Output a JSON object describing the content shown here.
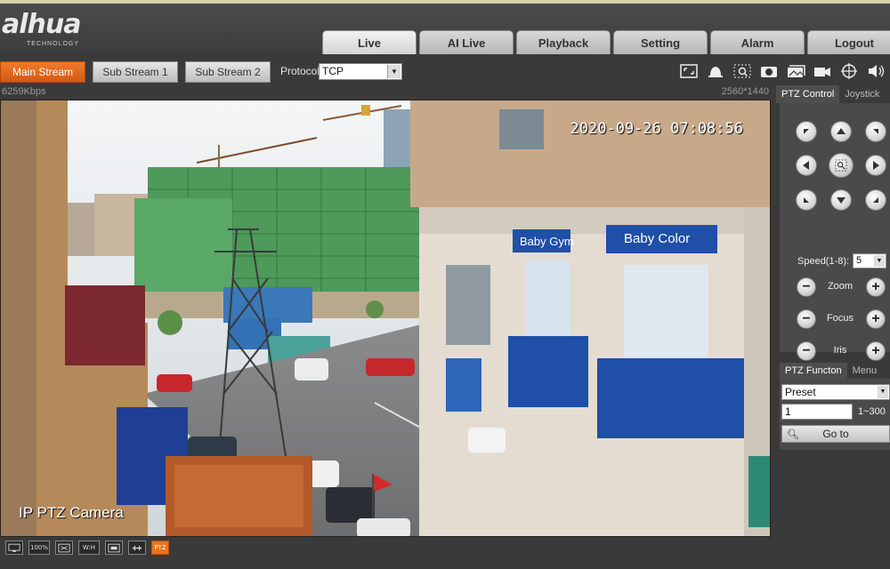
{
  "brand": {
    "name": "alhua",
    "tagline": "TECHNOLOGY"
  },
  "nav": {
    "tabs": [
      {
        "label": "Live",
        "active": true
      },
      {
        "label": "AI Live",
        "active": false
      },
      {
        "label": "Playback",
        "active": false
      },
      {
        "label": "Setting",
        "active": false
      },
      {
        "label": "Alarm",
        "active": false
      },
      {
        "label": "Logout",
        "active": false
      }
    ]
  },
  "toolbar": {
    "streams": [
      {
        "label": "Main Stream",
        "active": true
      },
      {
        "label": "Sub Stream 1",
        "active": false
      },
      {
        "label": "Sub Stream 2",
        "active": false
      }
    ],
    "protocol_label": "Protocol",
    "protocol_value": "TCP",
    "icons": [
      "fullscreen-icon",
      "alarm-bell-icon",
      "zoom-region-icon",
      "snapshot-icon",
      "burst-snapshot-icon",
      "record-icon",
      "target-icon",
      "audio-icon"
    ]
  },
  "status": {
    "bitrate": "6259Kbps",
    "resolution": "2560*1440"
  },
  "video": {
    "timestamp": "2020-09-26 07:08:56",
    "camera_name": "IP PTZ Camera",
    "signs": {
      "gym": "Baby Gym",
      "color": "Baby Color"
    }
  },
  "bottombar": {
    "items": [
      {
        "name": "monitor-icon",
        "text": ""
      },
      {
        "name": "original-size-button",
        "text": "100%"
      },
      {
        "name": "fit-window-button",
        "text": ""
      },
      {
        "name": "aspect-ratio-button",
        "text": "W:H"
      },
      {
        "name": "display-mode-button",
        "text": ""
      },
      {
        "name": "fluency-button",
        "text": ""
      },
      {
        "name": "ptz-button",
        "text": "PTZ"
      }
    ]
  },
  "ptz": {
    "tabs": [
      "PTZ Control",
      "Joystick"
    ],
    "speed_label": "Speed(1-8):",
    "speed_value": "5",
    "zoom_label": "Zoom",
    "focus_label": "Focus",
    "iris_label": "Iris"
  },
  "ptz_function": {
    "tabs": [
      "PTZ Functon",
      "Menu"
    ],
    "mode_value": "Preset",
    "preset_value": "1",
    "range": "1~300",
    "goto_label": "Go to"
  }
}
